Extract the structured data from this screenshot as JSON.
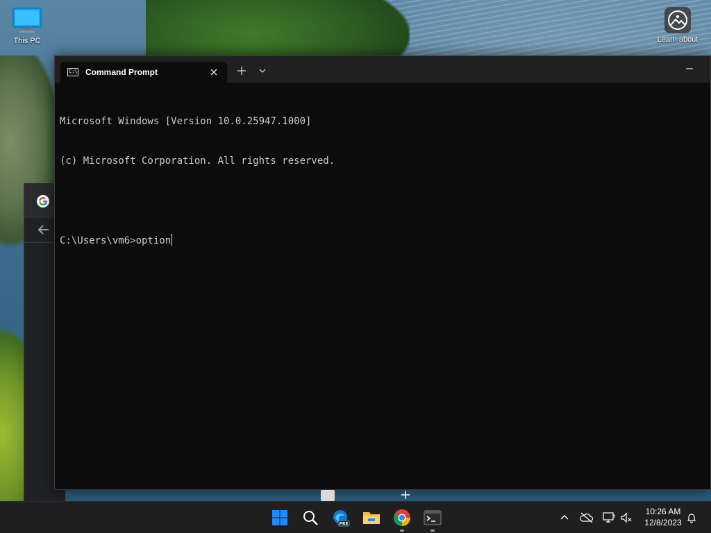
{
  "desktop": {
    "icons": [
      {
        "label": "This PC",
        "icon": "computer-icon"
      },
      {
        "label": "Learn about",
        "icon": "learn-about-picture-icon"
      }
    ]
  },
  "terminal": {
    "tab_title": "Command Prompt",
    "tab_icon": "cmd-icon",
    "tab_icon_glyph": "C:\\",
    "new_tab_icon": "plus-icon",
    "dropdown_icon": "chevron-down-icon",
    "minimize_icon": "minimize-icon",
    "lines": [
      "Microsoft Windows [Version 10.0.25947.1000]",
      "(c) Microsoft Corporation. All rights reserved.",
      "",
      "C:\\Users\\vm6>option"
    ]
  },
  "background_browser": {
    "tab_icon": "google-icon",
    "back_icon": "back-arrow-icon"
  },
  "taskbar": {
    "apps": [
      {
        "name": "start",
        "icon": "windows-start-icon",
        "running": false
      },
      {
        "name": "search",
        "icon": "search-icon",
        "running": false
      },
      {
        "name": "edge-preview",
        "icon": "edge-pre-icon",
        "badge": "PRE",
        "running": false
      },
      {
        "name": "file-explorer",
        "icon": "folder-icon",
        "running": false
      },
      {
        "name": "chrome",
        "icon": "chrome-icon",
        "running": true
      },
      {
        "name": "terminal",
        "icon": "terminal-icon",
        "running": true
      }
    ],
    "tray": {
      "icons": [
        "chevron-up-icon",
        "onedrive-offline-icon",
        "network-icon",
        "volume-muted-icon",
        "notification-bell-icon"
      ],
      "time": "10:26 AM",
      "date": "12/8/2023"
    }
  },
  "colors": {
    "console_bg": "#0c0c0c",
    "console_text": "#cccccc",
    "titlebar_bg": "#202020",
    "taskbar_bg": "#1f1f1f",
    "accent_blue": "#1a8cff"
  }
}
